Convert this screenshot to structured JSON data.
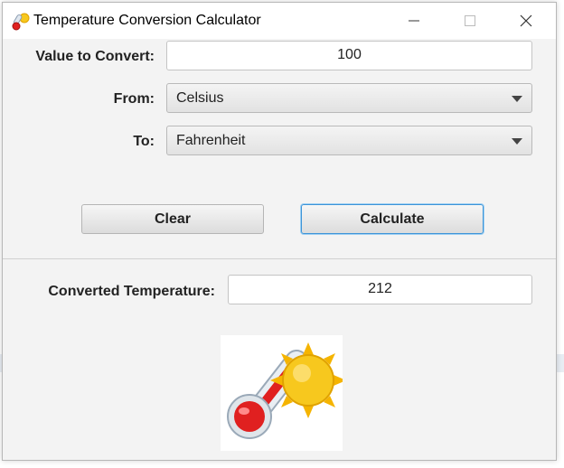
{
  "window": {
    "title": "Temperature Conversion Calculator"
  },
  "form": {
    "value_label": "Value to Convert:",
    "value": "100",
    "from_label": "From:",
    "from_selected": "Celsius",
    "to_label": "To:",
    "to_selected": "Fahrenheit"
  },
  "buttons": {
    "clear": "Clear",
    "calculate": "Calculate"
  },
  "result": {
    "label": "Converted Temperature:",
    "value": "212"
  },
  "icons": {
    "app": "thermometer-sun-icon",
    "picture": "thermometer-sun-icon",
    "dropdown": "chevron-down-icon",
    "minimize": "minimize-icon",
    "maximize": "maximize-icon",
    "close": "close-icon"
  },
  "colors": {
    "accent_border": "#3c94d8",
    "thermo_red": "#e02020",
    "sun_yellow": "#f7c81e"
  }
}
